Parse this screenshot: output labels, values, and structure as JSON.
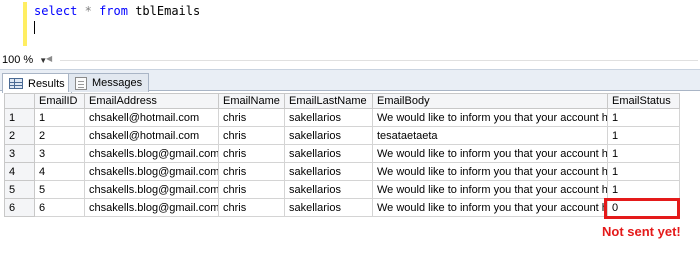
{
  "editor": {
    "tokens": {
      "select": "select",
      "star": "*",
      "from": "from",
      "table": "tblEmails"
    }
  },
  "zoom": {
    "value": "100 %"
  },
  "tabs": [
    {
      "label": "Results",
      "icon": "grid-icon",
      "active": true
    },
    {
      "label": "Messages",
      "icon": "message-icon",
      "active": false
    }
  ],
  "results": {
    "columns": [
      "EmailID",
      "EmailAddress",
      "EmailName",
      "EmailLastName",
      "EmailBody",
      "EmailStatus"
    ],
    "rows": [
      {
        "num": "1",
        "cells": [
          "1",
          "chsakell@hotmail.com",
          "chris",
          "sakellarios",
          "We would like to inform you that your account h...",
          "1"
        ]
      },
      {
        "num": "2",
        "cells": [
          "2",
          "chsakell@hotmail.com",
          "chris",
          "sakellarios",
          "tesataetaeta",
          "1"
        ]
      },
      {
        "num": "3",
        "cells": [
          "3",
          "chsakells.blog@gmail.com",
          "chris",
          "sakellarios",
          "We would like to inform you that your account h...",
          "1"
        ]
      },
      {
        "num": "4",
        "cells": [
          "4",
          "chsakells.blog@gmail.com",
          "chris",
          "sakellarios",
          "We would like to inform you that your account h...",
          "1"
        ]
      },
      {
        "num": "5",
        "cells": [
          "5",
          "chsakells.blog@gmail.com",
          "chris",
          "sakellarios",
          "We would like to inform you that your account h...",
          "1"
        ]
      },
      {
        "num": "6",
        "cells": [
          "6",
          "chsakells.blog@gmail.com",
          "chris",
          "sakellarios",
          "We would like to inform you that your account h...",
          "0"
        ]
      }
    ]
  },
  "annotation": {
    "text": "Not sent yet!",
    "color": "#e41a1a"
  }
}
